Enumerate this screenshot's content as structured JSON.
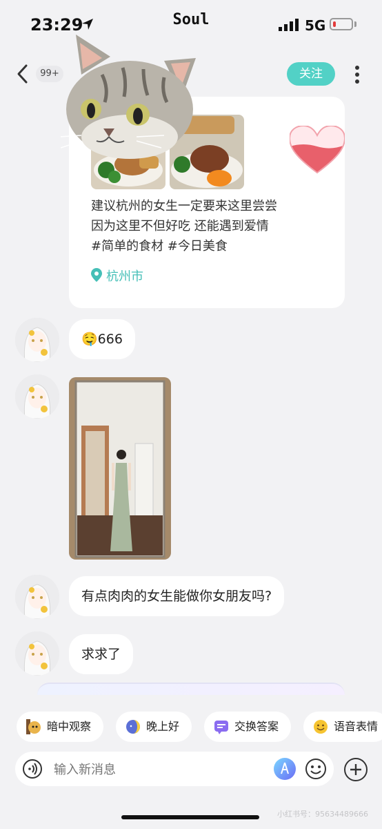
{
  "status_bar": {
    "time": "23:29",
    "app_name": "Soul",
    "network": "5G",
    "battery_level": 0.15,
    "battery_color": "#e23b3b"
  },
  "nav": {
    "unread_badge": "99+",
    "follow_label": "关注",
    "accent_color": "#52d1c6"
  },
  "post": {
    "text_line1": "建议杭州的女生一定要来这里尝尝",
    "text_line2": "因为这里不但好吃 还能遇到爱情",
    "text_line3": "#简单的食材 #今日美食",
    "location": "杭州市"
  },
  "messages": [
    {
      "type": "text",
      "emoji": "🤤",
      "text": "666"
    },
    {
      "type": "image"
    },
    {
      "type": "text",
      "text": "有点肉肉的女生能做你女朋友吗?"
    },
    {
      "type": "text",
      "text": "求求了"
    }
  ],
  "quick_replies": [
    {
      "icon": "peek-dog-icon",
      "label": "暗中观察"
    },
    {
      "icon": "moon-face-icon",
      "label": "晚上好"
    },
    {
      "icon": "qa-icon",
      "label": "交换答案"
    },
    {
      "icon": "smile-face-icon",
      "label": "语音表情"
    }
  ],
  "input": {
    "placeholder": "输入新消息"
  },
  "watermark": "小红书号：95634489666"
}
